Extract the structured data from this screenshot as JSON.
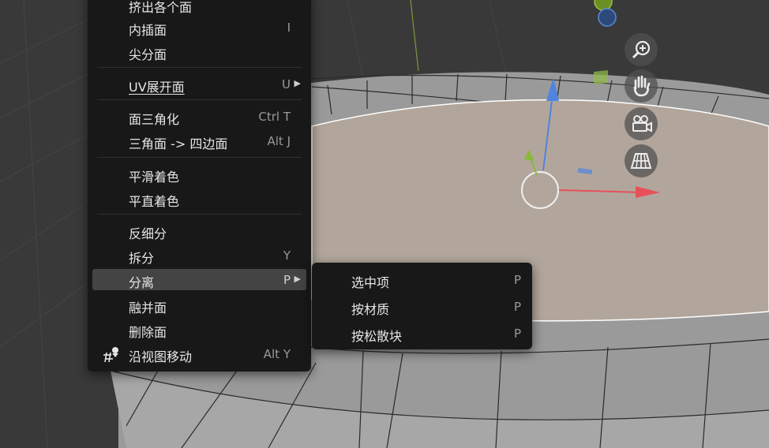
{
  "context_menu": {
    "items": [
      {
        "label": "挤出各个面",
        "shortcut": ""
      },
      {
        "label": "内插面",
        "shortcut": "I"
      },
      {
        "label": "尖分面",
        "shortcut": ""
      },
      {
        "label": "UV展开面",
        "shortcut": "U"
      },
      {
        "label": "面三角化",
        "shortcut": "Ctrl T"
      },
      {
        "label": "三角面 -> 四边面",
        "shortcut": "Alt J"
      },
      {
        "label": "平滑着色",
        "shortcut": ""
      },
      {
        "label": "平直着色",
        "shortcut": ""
      },
      {
        "label": "反细分",
        "shortcut": ""
      },
      {
        "label": "拆分",
        "shortcut": "Y"
      },
      {
        "label": "分离",
        "shortcut": "P"
      },
      {
        "label": "融并面",
        "shortcut": ""
      },
      {
        "label": "删除面",
        "shortcut": ""
      },
      {
        "label": "沿视图移动",
        "shortcut": "Alt Y"
      }
    ]
  },
  "separate_submenu": {
    "items": [
      {
        "label": "选中项",
        "shortcut": "P"
      },
      {
        "label": "按材质",
        "shortcut": "P"
      },
      {
        "label": "按松散块",
        "shortcut": "P"
      }
    ]
  },
  "icons": {
    "zoom": "zoom-in-icon",
    "pan": "hand-icon",
    "camera": "camera-icon",
    "grid": "perspective-grid-icon",
    "move_along_view": "move-along-view-icon"
  },
  "colors": {
    "menu_bg": "#181818",
    "menu_hover": "#444444",
    "selected_face": "#b2a69c",
    "axis_x": "#e8505a",
    "axis_y": "#8ab83a",
    "axis_z": "#4f84e0"
  }
}
